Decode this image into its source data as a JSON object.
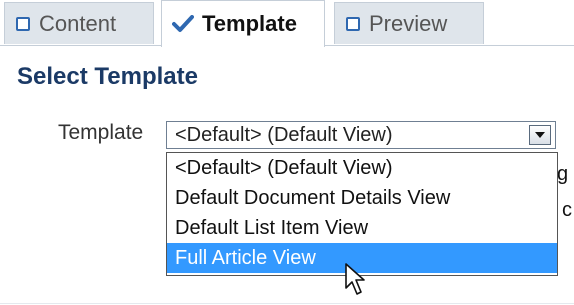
{
  "tabs": [
    {
      "label": "Content",
      "active": false
    },
    {
      "label": "Template",
      "active": true
    },
    {
      "label": "Preview",
      "active": false
    }
  ],
  "heading": "Select Template",
  "template_field": {
    "label": "Template",
    "selected_value": "<Default> (Default View)"
  },
  "dropdown_options": [
    "<Default> (Default View)",
    "Default Document Details View",
    "Default List Item View",
    "Full Article View"
  ],
  "highlighted_option": "Full Article View",
  "behind_text": [
    "g",
    "c"
  ],
  "colors": {
    "accent": "#2f68b0",
    "heading": "#1b3a66",
    "tab_bg": "#dfe5eb",
    "selection": "#3399ff"
  },
  "icons": {
    "content_tab": "checkbox-empty-icon",
    "template_tab": "checkmark-icon",
    "preview_tab": "checkbox-empty-icon",
    "dropdown": "chevron-down-icon",
    "cursor": "mouse-pointer-icon"
  }
}
